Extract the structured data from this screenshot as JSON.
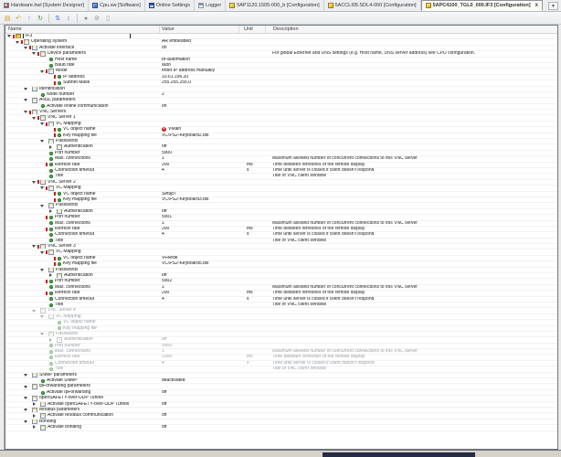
{
  "window": {
    "tab_overflow_icon": "▼"
  },
  "tabs": [
    {
      "label": "Hardware.hwl [System Designer]",
      "icon": "hardware-icon",
      "active": false
    },
    {
      "label": "Cpu.sw [Software]",
      "icon": "software-icon",
      "active": false
    },
    {
      "label": "Online Settings",
      "icon": "online-settings-icon",
      "active": false
    },
    {
      "label": "Logger",
      "icon": "logger-icon",
      "active": false
    },
    {
      "label": "5AP1120.1505-000_b [Configuration]",
      "icon": "configuration-icon",
      "active": false
    },
    {
      "label": "5ACCLI05.SDL4-000 [Configuration]",
      "icon": "configuration-icon",
      "active": false
    },
    {
      "label": "5APC4100_TGL0_000.IF3 [Configuration]",
      "icon": "configuration-icon",
      "active": true,
      "close_label": "x"
    }
  ],
  "toolbar": {
    "icons": [
      {
        "name": "export-config-icon",
        "glyph": "▤",
        "color": "#c9a227"
      },
      {
        "name": "undo-icon",
        "glyph": "↶",
        "color": "#d0a020"
      },
      {
        "name": "move-up-icon",
        "glyph": "↑",
        "color": "#4a7fd0"
      },
      {
        "name": "refresh-icon",
        "glyph": "↻",
        "color": "#3a9a3a"
      },
      {
        "name": "sort-descending-icon",
        "glyph": "⇅",
        "color": "#3a6fd0"
      },
      {
        "name": "sort-ascending-icon",
        "glyph": "↕",
        "color": "#3a6fd0"
      },
      {
        "name": "record-icon",
        "glyph": "●",
        "color": "#8a8f94"
      },
      {
        "name": "disable-icon",
        "glyph": "⊘",
        "color": "#8a8f94"
      },
      {
        "name": "column-options-icon",
        "glyph": "▯",
        "color": "#8a94a8"
      }
    ]
  },
  "table": {
    "columns": [
      "Name",
      "Value",
      "Unit",
      "Description"
    ]
  },
  "rows": [
    {
      "n": "IF3",
      "d": 0,
      "t": "r",
      "c": "o",
      "m": 1,
      "sel": 1
    },
    {
      "n": "Operating system",
      "d": 1,
      "t": "g",
      "c": "o",
      "m": 1,
      "v": "AR embedded"
    },
    {
      "n": "Activate interface",
      "d": 2,
      "t": "g",
      "c": "o",
      "m": 1,
      "v": "on"
    },
    {
      "n": "Device parameters",
      "d": 3,
      "t": "g",
      "c": "o",
      "m": 1,
      "ds": "For global Ethernet and DNS settings (e.g. Host name, DNS server address) see CPU configuration."
    },
    {
      "n": "Host name",
      "d": 4,
      "t": "l",
      "v": "br-automation"
    },
    {
      "n": "Baud rate",
      "d": 4,
      "t": "l",
      "v": "auto"
    },
    {
      "n": "Mode",
      "d": 4,
      "t": "g",
      "c": "o",
      "m": 1,
      "v": "enter IP address manually"
    },
    {
      "n": "IP address",
      "d": 5,
      "t": "l",
      "m": 1,
      "v": "10.61.196.20"
    },
    {
      "n": "Subnet Mask",
      "d": 5,
      "t": "l",
      "m": 1,
      "v": "255.255.255.0"
    },
    {
      "n": "Identification",
      "d": 2,
      "t": "g",
      "c": "o"
    },
    {
      "n": "Node number",
      "d": 3,
      "t": "l",
      "v": "2"
    },
    {
      "n": "ANSL parameters",
      "d": 2,
      "t": "g",
      "c": "o"
    },
    {
      "n": "Activate online communication",
      "d": 3,
      "t": "l",
      "v": "on"
    },
    {
      "n": "VNC Servers",
      "d": 2,
      "t": "g",
      "c": "o",
      "m": 1
    },
    {
      "n": "VNC Server 1",
      "d": 3,
      "t": "g",
      "c": "o",
      "m": 1
    },
    {
      "n": "VC Mapping",
      "d": 4,
      "t": "g",
      "c": "o",
      "m": 1
    },
    {
      "n": "VC object name",
      "d": 5,
      "t": "l",
      "m": 1,
      "v": "VMain",
      "e": 1
    },
    {
      "n": "Key mapping file",
      "d": 5,
      "t": "l",
      "m": 1,
      "v": "VC\\PS2-Keyboard2.dis"
    },
    {
      "n": "Passwords",
      "d": 4,
      "t": "g",
      "c": "o"
    },
    {
      "n": "Authentication",
      "d": 5,
      "t": "g",
      "c": "c",
      "v": "off"
    },
    {
      "n": "Port number",
      "d": 4,
      "t": "l",
      "v": "5900"
    },
    {
      "n": "Max. connections",
      "d": 4,
      "t": "l",
      "v": "1",
      "ds": "Maximum allowed number of concurrent connections to this VNC server"
    },
    {
      "n": "Refresh rate",
      "d": 4,
      "t": "l",
      "m": 1,
      "v": "200",
      "u": "ms",
      "ds": "Time between refreshes of the remote display"
    },
    {
      "n": "Connection timeout",
      "d": 4,
      "t": "l",
      "v": "4",
      "u": "s",
      "ds": "Time until server is closed if client doesn't respond"
    },
    {
      "n": "Title",
      "d": 4,
      "t": "l",
      "ds": "Title of VNC client Window"
    },
    {
      "n": "VNC Server 2",
      "d": 3,
      "t": "g",
      "c": "o",
      "m": 1
    },
    {
      "n": "VC Mapping",
      "d": 4,
      "t": "g",
      "c": "o",
      "m": 1
    },
    {
      "n": "VC object name",
      "d": 5,
      "t": "l",
      "m": 1,
      "v": "SetupT"
    },
    {
      "n": "Key mapping file",
      "d": 5,
      "t": "l",
      "m": 1,
      "v": "VC\\PS2-Keyboard3.dis"
    },
    {
      "n": "Passwords",
      "d": 4,
      "t": "g",
      "c": "o"
    },
    {
      "n": "Authentication",
      "d": 5,
      "t": "g",
      "c": "c",
      "v": "off"
    },
    {
      "n": "Port number",
      "d": 4,
      "t": "l",
      "m": 1,
      "v": "5901"
    },
    {
      "n": "Max. connections",
      "d": 4,
      "t": "l",
      "v": "1",
      "ds": "Maximum allowed number of concurrent connections to this VNC server"
    },
    {
      "n": "Refresh rate",
      "d": 4,
      "t": "l",
      "m": 1,
      "v": "200",
      "u": "ms",
      "ds": "Time between refreshes of the remote display"
    },
    {
      "n": "Connection timeout",
      "d": 4,
      "t": "l",
      "v": "4",
      "u": "s",
      "ds": "Time until server is closed if client doesn't respond"
    },
    {
      "n": "Title",
      "d": 4,
      "t": "l",
      "ds": "Title of VNC client Window"
    },
    {
      "n": "VNC Server 3",
      "d": 3,
      "t": "g",
      "c": "o",
      "m": 1
    },
    {
      "n": "VC Mapping",
      "d": 4,
      "t": "g",
      "c": "o",
      "m": 1
    },
    {
      "n": "VC object name",
      "d": 5,
      "t": "l",
      "m": 1,
      "v": "VFeede"
    },
    {
      "n": "Key mapping file",
      "d": 5,
      "t": "l",
      "m": 1,
      "v": "VC\\PS2-Keyboard5.dis"
    },
    {
      "n": "Passwords",
      "d": 4,
      "t": "g",
      "c": "o"
    },
    {
      "n": "Authentication",
      "d": 5,
      "t": "g",
      "c": "c",
      "v": "off"
    },
    {
      "n": "Port number",
      "d": 4,
      "t": "l",
      "m": 1,
      "v": "5902"
    },
    {
      "n": "Max. connections",
      "d": 4,
      "t": "l",
      "v": "1",
      "ds": "Maximum allowed number of concurrent connections to this VNC server"
    },
    {
      "n": "Refresh rate",
      "d": 4,
      "t": "l",
      "m": 1,
      "v": "200",
      "u": "ms",
      "ds": "Time between refreshes of the remote display"
    },
    {
      "n": "Connection timeout",
      "d": 4,
      "t": "l",
      "v": "4",
      "u": "s",
      "ds": "Time until server is closed if client doesn't respond"
    },
    {
      "n": "Title",
      "d": 4,
      "t": "l",
      "ds": "Title of VNC client Window"
    },
    {
      "n": "VNC Server 4",
      "d": 3,
      "t": "g",
      "c": "o",
      "x": 1
    },
    {
      "n": "VC Mapping",
      "d": 4,
      "t": "g",
      "c": "o",
      "x": 1
    },
    {
      "n": "VC object name",
      "d": 5,
      "t": "l",
      "x": 1
    },
    {
      "n": "Key mapping file",
      "d": 5,
      "t": "l",
      "x": 1
    },
    {
      "n": "Passwords",
      "d": 4,
      "t": "g",
      "c": "o",
      "x": 1
    },
    {
      "n": "Authentication",
      "d": 5,
      "t": "g",
      "c": "c",
      "x": 1,
      "v": "off"
    },
    {
      "n": "Port number",
      "d": 4,
      "t": "l",
      "x": 1,
      "v": "5900"
    },
    {
      "n": "Max. connections",
      "d": 4,
      "t": "l",
      "x": 1,
      "v": "1",
      "ds": "Maximum allowed number of concurrent connections to this VNC server"
    },
    {
      "n": "Refresh rate",
      "d": 4,
      "t": "l",
      "x": 1,
      "v": "1000",
      "u": "ms",
      "ds": "Time between refreshes of the remote display"
    },
    {
      "n": "Connection timeout",
      "d": 4,
      "t": "l",
      "x": 1,
      "v": "4",
      "u": "s",
      "ds": "Time until server is closed if client doesn't respond"
    },
    {
      "n": "Title",
      "d": 4,
      "t": "l",
      "x": 1,
      "ds": "Title of VNC client Window"
    },
    {
      "n": "SNMP parameters",
      "d": 2,
      "t": "g",
      "c": "o"
    },
    {
      "n": "Activate SNMP",
      "d": 3,
      "t": "l",
      "v": "deactivated"
    },
    {
      "n": "IpForwarding parameters",
      "d": 2,
      "t": "g",
      "c": "o"
    },
    {
      "n": "Activate IpForwarding",
      "d": 3,
      "t": "l",
      "v": "off"
    },
    {
      "n": "openSAFETY-over-UDP Tunnel",
      "d": 2,
      "t": "g",
      "c": "o"
    },
    {
      "n": "Activate openSAFETY-over-UDP Tunnel",
      "d": 3,
      "t": "g",
      "c": "c",
      "v": "off"
    },
    {
      "n": "Modbus parameters",
      "d": 2,
      "t": "g",
      "c": "o"
    },
    {
      "n": "Activate Modbus communication",
      "d": 3,
      "t": "g",
      "c": "c",
      "v": "off"
    },
    {
      "n": "Bonding",
      "d": 2,
      "t": "g",
      "c": "o"
    },
    {
      "n": "Activate bonding",
      "d": 3,
      "t": "g",
      "c": "c",
      "v": "off"
    }
  ],
  "colors": {
    "modified_marker": "#cf1616",
    "error_badge": "#cc2020",
    "leaf_bullet": "#2c8f2c",
    "config_tab_icon": "#f0c12a"
  }
}
